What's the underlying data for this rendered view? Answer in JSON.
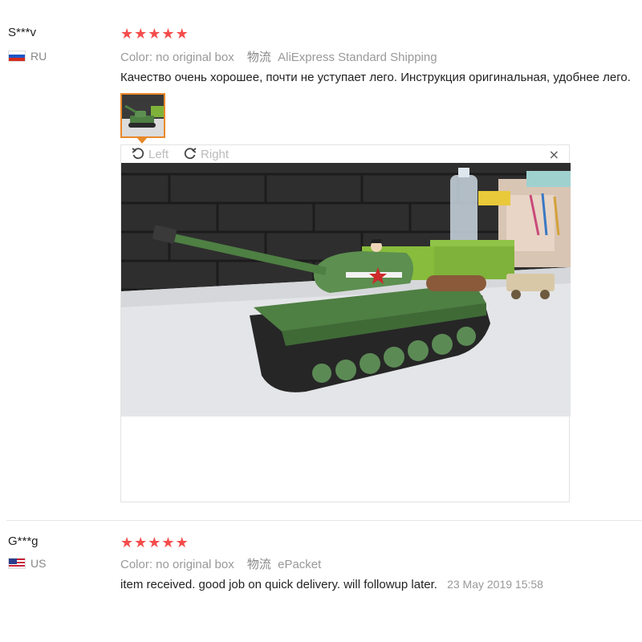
{
  "reviews": [
    {
      "user": "S***v",
      "country": "RU",
      "stars": [
        "★",
        "★",
        "★",
        "★",
        "★"
      ],
      "color_text": "Color: no original box",
      "logistics_label": "物流",
      "shipping": "AliExpress Standard Shipping",
      "feedback": "Качество очень хорошее, почти не уступает лего. Инструкция оригинальная, удобнее лего.",
      "viewer": {
        "rotate_left": "Left",
        "rotate_right": "Right",
        "close": "×"
      }
    },
    {
      "user": "G***g",
      "country": "US",
      "stars": [
        "★",
        "★",
        "★",
        "★",
        "★"
      ],
      "color_text": "Color: no original box",
      "logistics_label": "物流",
      "shipping": "ePacket",
      "feedback": "item received. good job on quick delivery. will followup later.",
      "date": "23 May 2019 15:58"
    }
  ],
  "colors": {
    "star": "#f54c4c",
    "thumb_border": "#e8892a",
    "tank_green": "#4e7f43",
    "brick_wall": "#2b2b2b"
  }
}
